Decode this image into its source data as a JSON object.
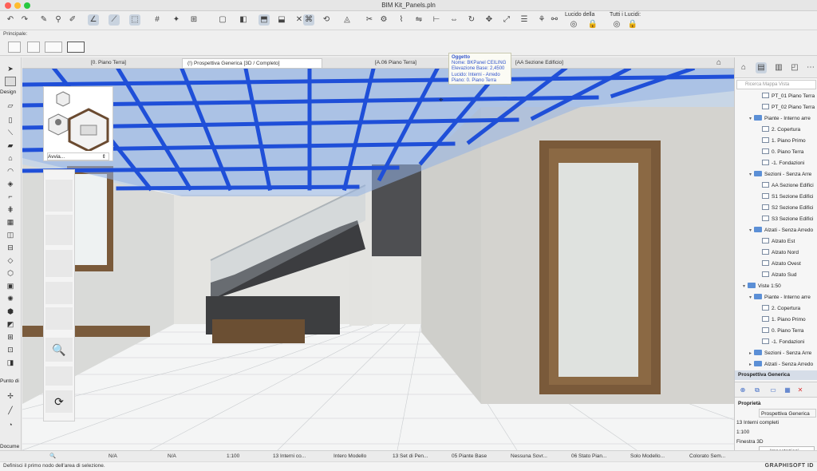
{
  "window": {
    "title": "BIM Kit_Panels.pln"
  },
  "toolbar": {
    "lucido_label": "Lucido della",
    "tutti_label": "Tutti i Lucidi:"
  },
  "principale": {
    "label": "Principale:"
  },
  "tabs": [
    {
      "label": "[0. Piano Terra]"
    },
    {
      "label": "(!) Prospettiva Generica [3D / Completo]"
    },
    {
      "label": "[A.06 Piano Terra]"
    },
    {
      "label": "[AA Sezione Edificio]"
    }
  ],
  "left_tools": {
    "design_label": "Design",
    "punto_label": "Punto di",
    "docume_label": "Docume"
  },
  "tooltip": {
    "title": "Oggetto",
    "lines": [
      "Nome: BKPanel CEILING",
      "Elevazione Base: 2,4500",
      "Lucido: Interni - Arredo",
      "Piano: 0. Piano Terra"
    ]
  },
  "mini_panel": {
    "dropdown": "Avvia..."
  },
  "navigator": {
    "search_placeholder": "Ricerca Mappa Vista",
    "items": [
      {
        "label": "PT_01 Piano Terra",
        "level": 3,
        "kind": "view"
      },
      {
        "label": "PT_02 Piano Terra",
        "level": 3,
        "kind": "view"
      },
      {
        "label": "Piante - Interno arre",
        "level": 2,
        "kind": "folder",
        "open": true
      },
      {
        "label": "2. Copertura",
        "level": 3,
        "kind": "view"
      },
      {
        "label": "1. Piano Primo",
        "level": 3,
        "kind": "view"
      },
      {
        "label": "0. Piano Terra",
        "level": 3,
        "kind": "view"
      },
      {
        "label": "-1. Fondazioni",
        "level": 3,
        "kind": "view"
      },
      {
        "label": "Sezioni - Senza Arre",
        "level": 2,
        "kind": "folder",
        "open": true
      },
      {
        "label": "AA Sezione Edifici",
        "level": 3,
        "kind": "view"
      },
      {
        "label": "S1 Sezione Edifici",
        "level": 3,
        "kind": "view"
      },
      {
        "label": "S2 Sezione Edifici",
        "level": 3,
        "kind": "view"
      },
      {
        "label": "S3 Sezione Edifici",
        "level": 3,
        "kind": "view"
      },
      {
        "label": "Alzati - Senza Arredo",
        "level": 2,
        "kind": "folder",
        "open": true
      },
      {
        "label": "Alzato Est",
        "level": 3,
        "kind": "view"
      },
      {
        "label": "Alzato Nord",
        "level": 3,
        "kind": "view"
      },
      {
        "label": "Alzato Ovest",
        "level": 3,
        "kind": "view"
      },
      {
        "label": "Alzato Sud",
        "level": 3,
        "kind": "view"
      },
      {
        "label": "Viste 1:50",
        "level": 1,
        "kind": "folder",
        "open": true
      },
      {
        "label": "Piante - Interno arre",
        "level": 2,
        "kind": "folder",
        "open": true
      },
      {
        "label": "2. Copertura",
        "level": 3,
        "kind": "view"
      },
      {
        "label": "1. Piano Primo",
        "level": 3,
        "kind": "view"
      },
      {
        "label": "0. Piano Terra",
        "level": 3,
        "kind": "view"
      },
      {
        "label": "-1. Fondazioni",
        "level": 3,
        "kind": "view"
      },
      {
        "label": "Sezioni - Senza Arre",
        "level": 2,
        "kind": "folder",
        "open": false
      },
      {
        "label": "Alzati - Senza Arredo",
        "level": 2,
        "kind": "folder",
        "open": false
      }
    ],
    "selected": "Prospettiva Generica",
    "properties_title": "Proprietà",
    "prop_name": "Prospettiva Generica",
    "prop_layers": "13 Interni completi",
    "prop_scale": "1:100",
    "prop_window": "Finestra 3D",
    "settings_button": "Impostazioni..."
  },
  "statusbar": {
    "na1": "N/A",
    "na2": "N/A",
    "scale": "1:100",
    "layers": "13 Interni co...",
    "model": "Intero Modello",
    "pens": "13 Set di Pen...",
    "overrides": "05 Piante Base",
    "renov": "Nessuna Sovr...",
    "phase": "06 Stato Pian...",
    "modelonly": "Solo Modello...",
    "color": "Colorato Sem..."
  },
  "message": {
    "text": "Definisci il primo nodo dell'area di selezione.",
    "brand": "GRAPHISOFT ID"
  },
  "colors": {
    "beam_blue": "#1f4fd8",
    "panel_blue": "#7fa9e0",
    "wall": "#d3d3cf"
  }
}
